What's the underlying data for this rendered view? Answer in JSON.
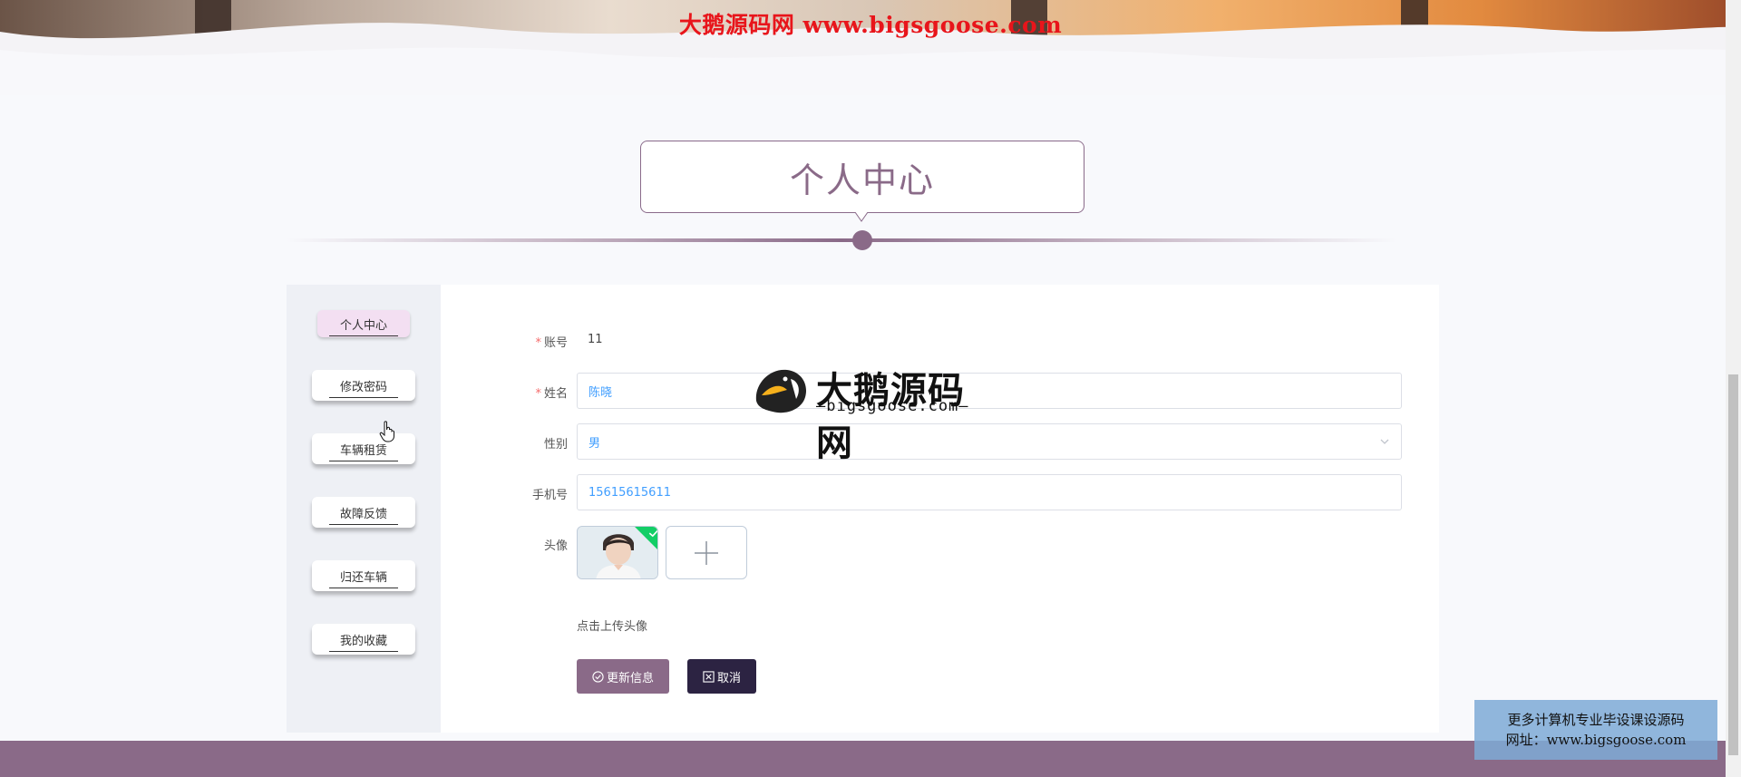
{
  "watermark_top": "大鹅源码网 www.bigsgoose.com",
  "page_title": "个人中心",
  "sidebar": {
    "items": [
      {
        "label": "个人中心",
        "active": true
      },
      {
        "label": "修改密码",
        "active": false
      },
      {
        "label": "车辆租赁",
        "active": false
      },
      {
        "label": "故障反馈",
        "active": false
      },
      {
        "label": "归还车辆",
        "active": false
      },
      {
        "label": "我的收藏",
        "active": false
      }
    ]
  },
  "form": {
    "account": {
      "label": "账号",
      "value": "11",
      "required": true
    },
    "name": {
      "label": "姓名",
      "value": "陈晓",
      "required": true
    },
    "gender": {
      "label": "性别",
      "value": "男"
    },
    "phone": {
      "label": "手机号",
      "value": "15615615611"
    },
    "avatar": {
      "label": "头像",
      "hint": "点击上传头像"
    }
  },
  "buttons": {
    "update": "更新信息",
    "cancel": "取消"
  },
  "logo_watermark": {
    "name": "大鹅源码网",
    "domain": "—bigsgoose.com—"
  },
  "ad_box": {
    "line1": "更多计算机专业毕设课设源码",
    "line2": "网址：www.bigsgoose.com"
  },
  "colors": {
    "accent": "#8a6a88",
    "cancel": "#2c2342",
    "required": "#f56c6c",
    "input_text": "#409eff",
    "watermark_red": "#e8151b"
  }
}
